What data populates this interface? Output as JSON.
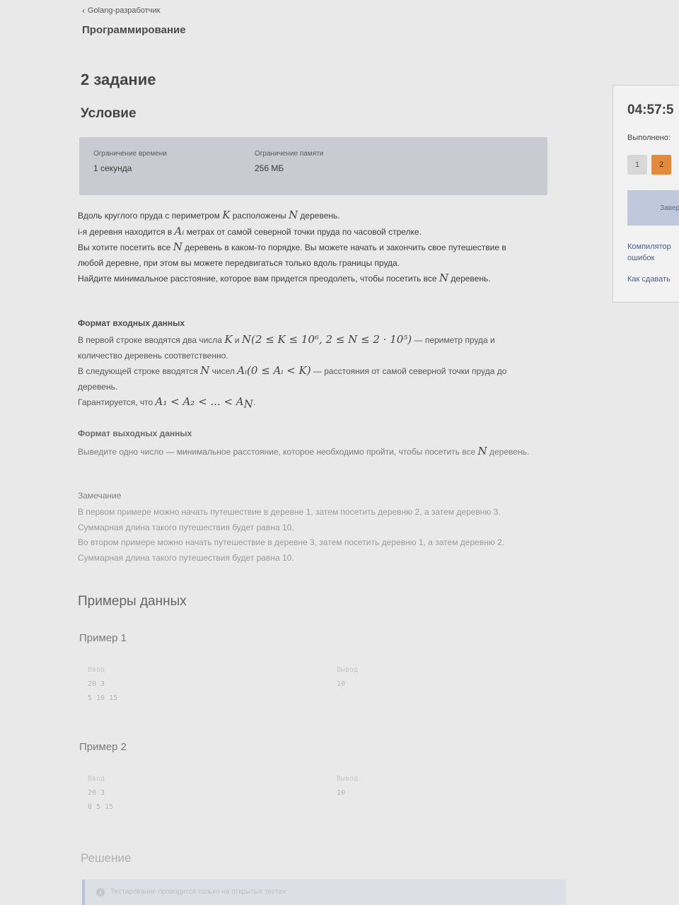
{
  "breadcrumb": {
    "back_label": "Golang-разработчик",
    "section": "Программирование"
  },
  "task": {
    "title": "2 задание",
    "condition_heading": "Условие",
    "limits": {
      "time_label": "Ограничение времени",
      "time_value": "1 секунда",
      "memory_label": "Ограничение памяти",
      "memory_value": "256 МБ"
    },
    "statement": {
      "l1a": "Вдоль круглого пруда с периметром ",
      "K": "K",
      "l1b": " расположены ",
      "N": "N",
      "l1c": " деревень.",
      "l2a": "i-я деревня находится в ",
      "Ai": "Aᵢ",
      "l2b": " метрах от самой северной точки пруда по часовой стрелке.",
      "l3a": "Вы хотите посетить все ",
      "l3b": " деревень в каком-то порядке. Вы можете начать и закончить свое путешествие в любой деревне, при этом вы можете передвигаться только вдоль границы пруда.",
      "l4a": "Найдите минимальное расстояние, которое вам придется преодолеть, чтобы посетить все ",
      "l4b": " деревень."
    },
    "input_format": {
      "heading": "Формат входных данных",
      "l1a": "В первой строке вводятся два числа ",
      "l1_and": " и ",
      "l1_constraint": "(2 ≤ K ≤ 10⁶, 2 ≤ N ≤ 2 · 10⁵)",
      "l1b": " — периметр пруда и количество деревень соответственно.",
      "l2a": "В следующей строке вводятся ",
      "l2_nums": " чисел ",
      "l2_constraint": "(0 ≤ Aᵢ < K)",
      "l2b": " — расстояния от самой северной точки пруда до деревень.",
      "l3a": "Гарантируется, что ",
      "l3_math": "A₁ < A₂ < ... < A",
      "l3_sub": "N",
      "l3b": "."
    },
    "output_format": {
      "heading": "Формат выходных данных",
      "text_a": "Выведите одно число — минимальное расстояние, которое необходимо пройти, чтобы посетить все ",
      "text_b": " деревень."
    },
    "note": {
      "heading": "Замечание",
      "l1": "В первом примере можно начать путешествие в деревне 1, затем посетить деревню 2, а затем деревню 3. Суммарная длина такого путешествия будет равна 10.",
      "l2": "Во втором примере можно начать путешествие в деревне 3, затем посетить деревню 1, а затем деревню 2. Суммарная длина такого путешествия будет равна 10."
    }
  },
  "examples": {
    "heading": "Примеры данных",
    "items": [
      {
        "title": "Пример 1",
        "input_header": "Ввод",
        "input_lines": [
          "20 3",
          "5 10 15"
        ],
        "output_header": "Вывод",
        "output": "10"
      },
      {
        "title": "Пример 2",
        "input_header": "Ввод",
        "input_lines": [
          "20 3",
          "0 5 15"
        ],
        "output_header": "Вывод",
        "output": "10"
      }
    ]
  },
  "solution": {
    "heading": "Решение",
    "info": "Тестирование проводится только на открытых тестах"
  },
  "sidebar": {
    "timer": "04:57:5",
    "done_label": "Выполнено:",
    "task_buttons": [
      "1",
      "2"
    ],
    "finish_label": "Завер",
    "compilers_line1": "Компилятор",
    "compilers_line2": "ошибок",
    "how_to_submit": "Как сдавать"
  },
  "icons": {
    "back": "chevron-left-icon",
    "info": "info-icon"
  },
  "colors": {
    "active_task": "#e58a3c",
    "limits_box": "#c9cbd3",
    "link": "#4a5f8a"
  }
}
